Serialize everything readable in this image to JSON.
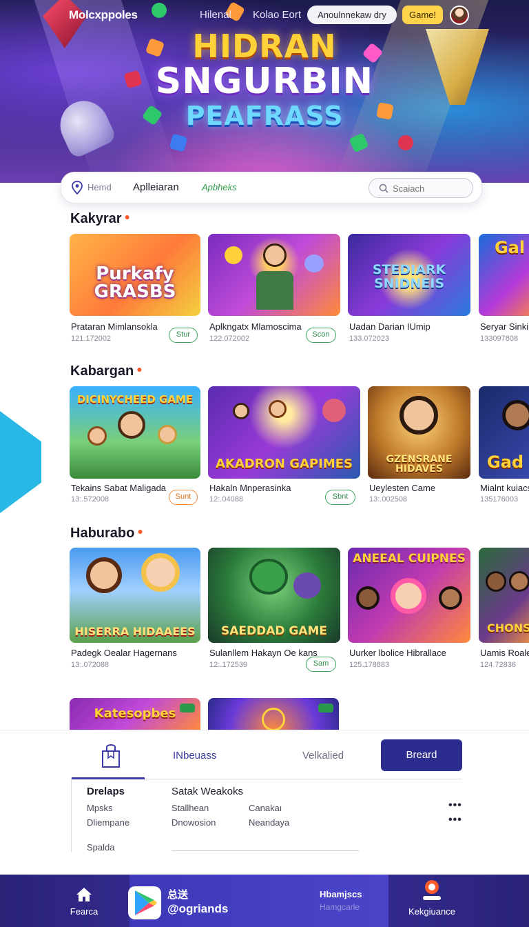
{
  "header": {
    "brand": "Molcxppoles",
    "nav_links": [
      "Hilenal",
      "Kolao Eort"
    ],
    "announce_button": "Anoulnnekaw dry",
    "game_button": "Game!"
  },
  "hero": {
    "title_line1": "HIDRAN",
    "title_line2": "SNGURBIN",
    "title_line3": "PEAFRASS"
  },
  "filter_bar": {
    "home_label": "Hemd",
    "app_label": "Aplleiaran",
    "apps_label": "Apbheks",
    "search_placeholder": "Scaiach"
  },
  "sections": [
    {
      "title": "Kakyrar",
      "cards": [
        {
          "art": "Purkafy GRASBS",
          "title": "Pratаran Mimlansokla",
          "date": "121.172002",
          "pill": "Stur"
        },
        {
          "art": "",
          "title": "Aplkngatx Mlamoscima",
          "date": "122.072002",
          "pill": "Scon"
        },
        {
          "art": "STEDIARK SNIDNEIS",
          "title": "Uadan Darian IUmip",
          "date": "133.072023",
          "pill": ""
        },
        {
          "art": "Gal",
          "title": "Seryar Sinki",
          "date": "133097808",
          "pill": ""
        }
      ]
    },
    {
      "title": "Kabargan",
      "cards": [
        {
          "art": "DICINYCHEED GAME",
          "title": "Tekains Sabat Maligada",
          "date": "13:.572008",
          "pill": "Sunt"
        },
        {
          "art": "AKADRON GAPIMES",
          "title": "Hakaln Mnperasinka",
          "date": "12:.04088",
          "pill": "Sbnt"
        },
        {
          "art": "GZENSRANE HIDAVES",
          "title": "Ueylesten Came",
          "date": "13:.002508",
          "pill": ""
        },
        {
          "art": "Gad",
          "title": "Mialnt kuiacs",
          "date": "135176003",
          "pill": ""
        }
      ]
    },
    {
      "title": "Haburabo",
      "cards": [
        {
          "art": "HISERRA HIDAAEES",
          "title": "Padegk Oealar Hagernans",
          "date": "13:.072088",
          "pill": ""
        },
        {
          "art": "SAEDDAD GAME",
          "title": "Sulanllem Hakayn Oe kans",
          "date": "12:.172539",
          "pill": "Sam"
        },
        {
          "art": "ANEEAL CUIPNES",
          "title": "Uurker lbolice Hibrallace",
          "date": "125.178883",
          "pill": ""
        },
        {
          "art": "CHONSS",
          "title": "Uamis Roale",
          "date": "124.72836",
          "pill": ""
        }
      ]
    },
    {
      "cards": [
        {
          "art": "Katesopbes"
        },
        {
          "art": ""
        }
      ]
    }
  ],
  "panel": {
    "tabs": [
      "INbeuass",
      "Velkalied"
    ],
    "primary_button": "Breard",
    "col1_header": "Drelaps",
    "col2_header": "Satak Weakoks",
    "rows": [
      [
        "Mpsks",
        "Stallhean",
        "Canakaı"
      ],
      [
        "Dliempane",
        "Dnowosion",
        "Neandaya"
      ]
    ],
    "footer_label": "Spalda"
  },
  "bottom_nav": {
    "home_label": "Fearca",
    "kanji": "总送",
    "handle": "@ogriands",
    "right_title": "Hbamjscs",
    "right_subtitle": "Hamgcarle",
    "profile_label": "Kekgiuance"
  }
}
